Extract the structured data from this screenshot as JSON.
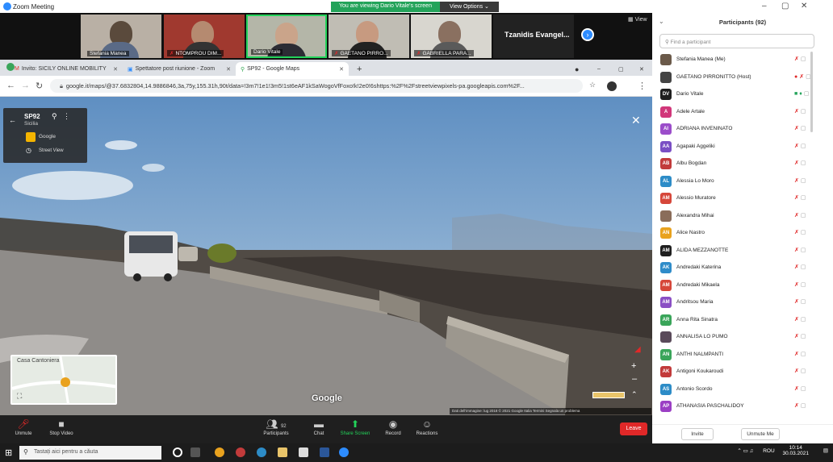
{
  "zoom": {
    "window_title": "Zoom Meeting",
    "sharing_banner": "You are viewing Dario Vitale's screen",
    "view_options": "View Options",
    "view_label": "View",
    "featured_name": "Tzanidis Evangel...",
    "thumbnails": [
      {
        "name": "Stefania Manea",
        "muted": false
      },
      {
        "name": "NTOMPROU DIM...",
        "muted": true
      },
      {
        "name": "Dario Vitale",
        "muted": false
      },
      {
        "name": "GAETANO PIRRO...",
        "muted": true
      },
      {
        "name": "GABRIELLA PARA...",
        "muted": true
      }
    ]
  },
  "chrome": {
    "tabs": [
      {
        "label": "Invito: SICILY ONLINE MOBILITY",
        "active": false
      },
      {
        "label": "Spettatore post riunione - Zoom",
        "active": false
      },
      {
        "label": "SP92 - Google Maps",
        "active": true
      }
    ],
    "url": "google.it/maps/@37.6832804,14.9886846,3a,75y,155.31h,90t/data=!3m7!1e1!3m5!1st6eAF1kSaWogoVfFoxo!k!2e0!6shttps:%2F%2Fstreetviewpixels-pa.googleapis.com%2F..."
  },
  "streetview": {
    "road_title": "SP92",
    "road_region": "Sicilia",
    "provider": "Google",
    "mode": "Street View",
    "minimap_place": "Casa Cantoniera",
    "logo": "Google",
    "attribution": "Dati dell'immagine: lug 2018   © 2021 Google   Italia   Termini   Segnala un problema"
  },
  "controls": {
    "unmute": "Unmute",
    "stop_video": "Stop Video",
    "participants": "Participants",
    "participants_count": "92",
    "chat": "Chat",
    "share_screen": "Share Screen",
    "record": "Record",
    "reactions": "Reactions",
    "leave": "Leave"
  },
  "participants_panel": {
    "title": "Participants (92)",
    "search_placeholder": "Find a participant",
    "invite": "Invite",
    "unmute_me": "Unmute Me",
    "list": [
      {
        "initials": "",
        "name": "Stefania Manea (Me)",
        "color": "#6b5a4a"
      },
      {
        "initials": "",
        "name": "GAETANO PIRRONITTO (Host)",
        "color": "#444444"
      },
      {
        "initials": "DV",
        "name": "Dario Vitale",
        "color": "#1f1f1f"
      },
      {
        "initials": "A",
        "name": "Adele Artale",
        "color": "#d1377a"
      },
      {
        "initials": "AI",
        "name": "ADRIANA INVENINATO",
        "color": "#9b4dca"
      },
      {
        "initials": "AA",
        "name": "Agapaki Aggeliki",
        "color": "#7a4fc4"
      },
      {
        "initials": "AB",
        "name": "Albu Bogdan",
        "color": "#c23b3b"
      },
      {
        "initials": "AL",
        "name": "Alessia Lo Moro",
        "color": "#2d8cc7"
      },
      {
        "initials": "AM",
        "name": "Alessio Muratore",
        "color": "#d6473a"
      },
      {
        "initials": "",
        "name": "Alexandra Mihai",
        "color": "#8a6d5a"
      },
      {
        "initials": "AN",
        "name": "Alice Nastro",
        "color": "#e9a21e"
      },
      {
        "initials": "AM",
        "name": "ALIDA MEZZANOTTE",
        "color": "#1f1f1f"
      },
      {
        "initials": "AK",
        "name": "Andredaki Katerina",
        "color": "#2f8cc9"
      },
      {
        "initials": "AM",
        "name": "Andredaki Mikaela",
        "color": "#d6473a"
      },
      {
        "initials": "AM",
        "name": "Andritsou Maria",
        "color": "#8a4fc4"
      },
      {
        "initials": "AR",
        "name": "Anna Rita Sinatra",
        "color": "#3aa55a"
      },
      {
        "initials": "",
        "name": "ANNALISA LO PUMO",
        "color": "#5a4a5a"
      },
      {
        "initials": "AN",
        "name": "ANTHI NALMPANTI",
        "color": "#3aa55a"
      },
      {
        "initials": "AK",
        "name": "Antigoni Koukaroudi",
        "color": "#c23b3b"
      },
      {
        "initials": "AS",
        "name": "Antonio Scordo",
        "color": "#2d8cc7"
      },
      {
        "initials": "AP",
        "name": "ATHANASIA PASCHALIDOY",
        "color": "#9b3fc4"
      }
    ]
  },
  "taskbar": {
    "search_placeholder": "Tastați aici pentru a căuta",
    "language": "ROU",
    "time": "10:14",
    "date": "30.03.2021"
  }
}
